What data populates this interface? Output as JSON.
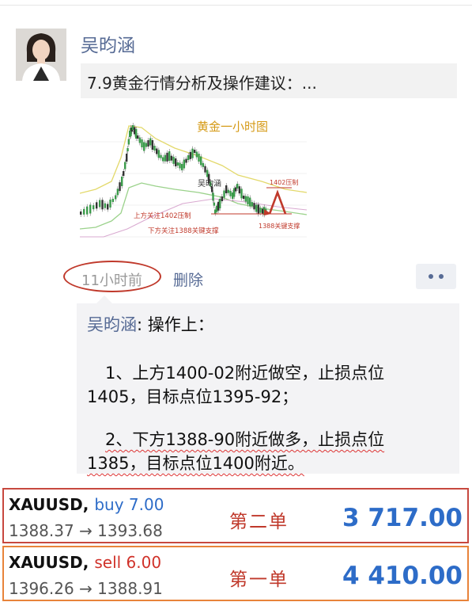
{
  "post": {
    "author": "吴昀涵",
    "link_title": "7.9黄金行情分析及操作建议：...",
    "image": {
      "chart_title": "黄金一小时图",
      "author_watermark": "吴昀涵",
      "resistance_label": "1402压制",
      "support_label": "1388关键支撑",
      "note_upper": "上方关注1402压制",
      "note_lower": "下方关注1388关键支撑"
    },
    "time": "11小时前",
    "delete_label": "删除"
  },
  "comment": {
    "author": "吴昀涵",
    "lead": ": 操作上：",
    "item1_line1": "1、上方1400-02附近做空，止损点位",
    "item1_line2": "1405，目标点位1395-92；",
    "item2_line1": "2、下方1388-90附近做多，止损点位",
    "item2_line2": "1385，目标点位1400附近。"
  },
  "trades": [
    {
      "symbol": "XAUUSD,",
      "side": "buy 7.00",
      "prices": "1388.37 → 1393.68",
      "label": "第二单",
      "profit": "3 717.00"
    },
    {
      "symbol": "XAUUSD,",
      "side": "sell 6.00",
      "prices": "1396.26 → 1388.91",
      "label": "第一单",
      "profit": "4 410.00"
    }
  ],
  "colors": {
    "link": "#576b95",
    "profit": "#2d6cc8",
    "buy": "#2d6cc8",
    "sell": "#d0322a",
    "annotation": "#c0392b"
  }
}
